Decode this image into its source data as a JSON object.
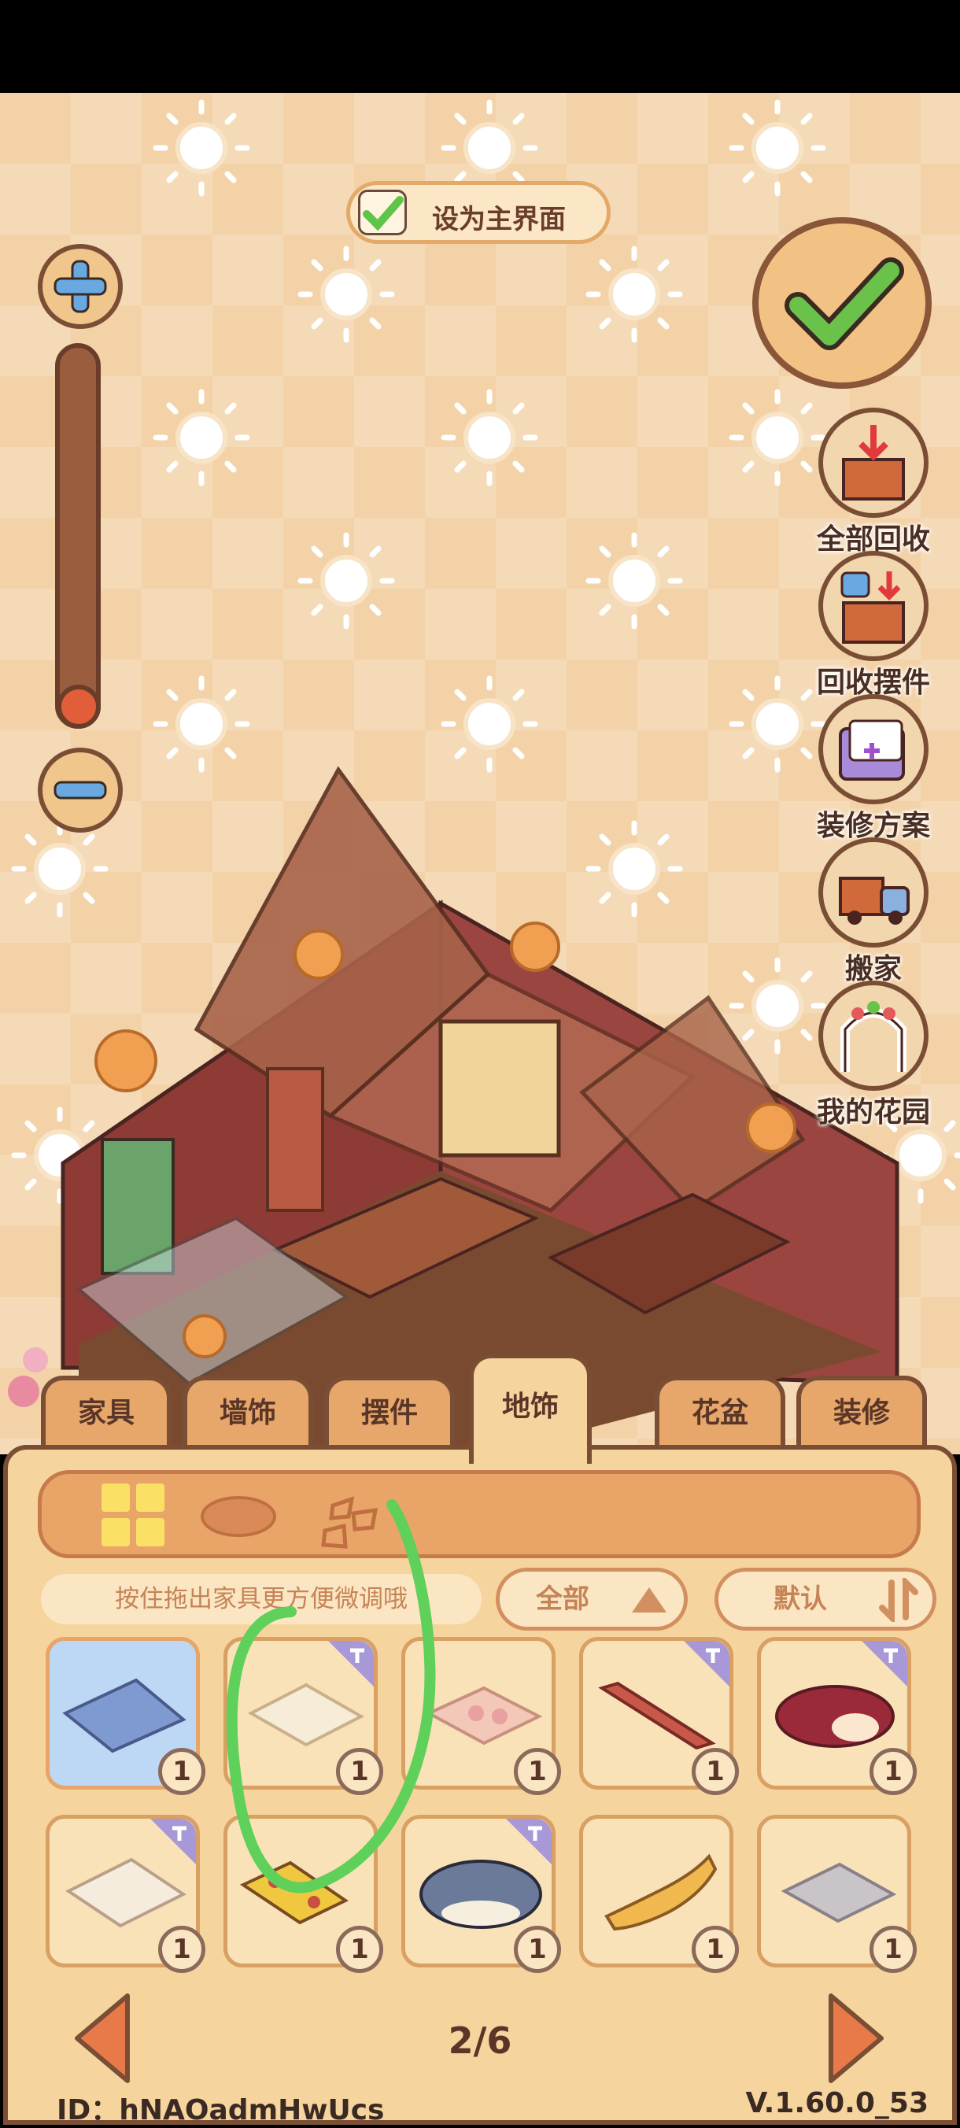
{
  "set_home": {
    "label": "设为主界面"
  },
  "side_menu": [
    {
      "label": "全部回收",
      "icon": "box-collect-icon"
    },
    {
      "label": "回收摆件",
      "icon": "box-collect-item-icon"
    },
    {
      "label": "装修方案",
      "icon": "folder-plan-icon"
    },
    {
      "label": "搬家",
      "icon": "moving-truck-icon"
    },
    {
      "label": "我的花园",
      "icon": "garden-arch-icon"
    }
  ],
  "tabs": [
    {
      "label": "家具",
      "active": false
    },
    {
      "label": "墙饰",
      "active": false
    },
    {
      "label": "摆件",
      "active": false
    },
    {
      "label": "地饰",
      "active": true
    },
    {
      "label": "花盆",
      "active": false
    },
    {
      "label": "装修",
      "active": false
    }
  ],
  "filter_icons": [
    "grid-icon",
    "oval-rug-icon",
    "stones-icon"
  ],
  "hint": "按住拖出家具更方便微调哦",
  "dropdowns": {
    "category": "全部",
    "sort": "默认"
  },
  "items": [
    {
      "name": "blue-tile-rug",
      "qty": "1",
      "tag": false,
      "selected": true
    },
    {
      "name": "cream-rug",
      "qty": "1",
      "tag": true,
      "selected": false
    },
    {
      "name": "pink-pattern-rug",
      "qty": "1",
      "tag": false,
      "selected": false
    },
    {
      "name": "red-stripe-runner",
      "qty": "1",
      "tag": true,
      "selected": false
    },
    {
      "name": "floral-oval-rug",
      "qty": "1",
      "tag": true,
      "selected": false
    },
    {
      "name": "diamond-lattice-rug",
      "qty": "1",
      "tag": true,
      "selected": false
    },
    {
      "name": "paw-print-mat",
      "qty": "1",
      "tag": false,
      "selected": false
    },
    {
      "name": "seal-cushion",
      "qty": "1",
      "tag": true,
      "selected": false
    },
    {
      "name": "cat-cushion",
      "qty": "1",
      "tag": false,
      "selected": false
    },
    {
      "name": "grey-mat",
      "qty": "1",
      "tag": false,
      "selected": false
    }
  ],
  "pagination": {
    "current": "2/6"
  },
  "footer": {
    "id": "ID：hNAOadmHwUcs",
    "version": "V.1.60.0_53"
  },
  "colors": {
    "panel": "#f6d49e",
    "border": "#7a4e34",
    "accent": "#e9a468",
    "annotation": "#5fd05a"
  }
}
